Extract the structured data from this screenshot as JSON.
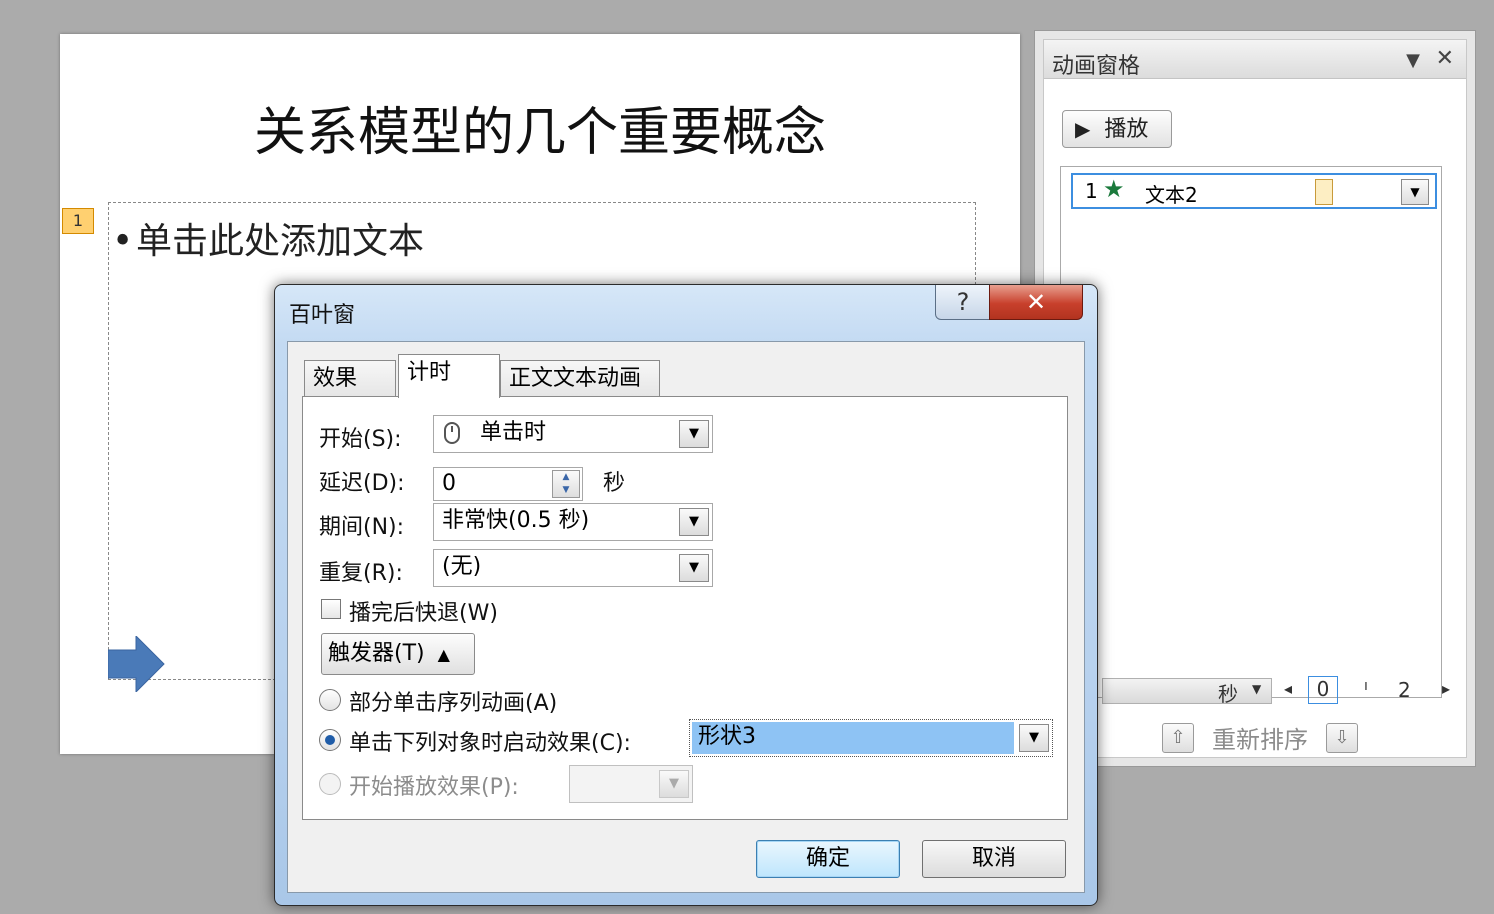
{
  "slide": {
    "title": "关系模型的几个重要概念",
    "animation_tag": "1",
    "bullet": "•",
    "placeholder_text": "单击此处添加文本"
  },
  "animation_pane": {
    "title": "动画窗格",
    "play_label": "播放",
    "items": [
      {
        "number": "1",
        "icon": "green-star-icon",
        "name": "文本2"
      }
    ],
    "timeline": {
      "unit": "秒",
      "start": "0",
      "mark": "2"
    },
    "reorder_label": "重新排序"
  },
  "dialog": {
    "title": "百叶窗",
    "help_label": "?",
    "close_label": "✕",
    "tabs": [
      "效果",
      "计时",
      "正文文本动画"
    ],
    "active_tab": "计时",
    "start_label": "开始(S):",
    "start_value": "单击时",
    "delay_label": "延迟(D):",
    "delay_value": "0",
    "delay_unit": "秒",
    "duration_label": "期间(N):",
    "duration_value": "非常快(0.5 秒)",
    "repeat_label": "重复(R):",
    "repeat_value": "(无)",
    "rewind_label": "播完后快退(W)",
    "rewind_checked": false,
    "trigger_label": "触发器(T)",
    "option_sequence": "部分单击序列动画(A)",
    "option_click": "单击下列对象时启动效果(C):",
    "option_click_value": "形状3",
    "option_play": "开始播放效果(P):",
    "ok_label": "确定",
    "cancel_label": "取消"
  },
  "colors": {
    "accent": "#3c8ee0",
    "highlight": "#8ec3f4",
    "close_red": "#c8402c",
    "slide_arrow": "#4a7ab8"
  }
}
